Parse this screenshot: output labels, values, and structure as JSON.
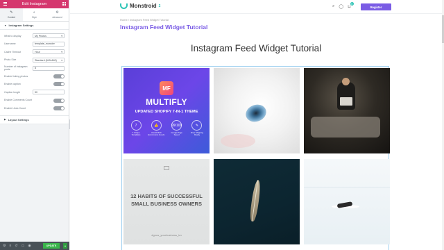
{
  "editor": {
    "title": "Edit Instagram",
    "tabs": [
      {
        "label": "Content",
        "icon": "pencil-icon"
      },
      {
        "label": "Style",
        "icon": "contrast-icon"
      },
      {
        "label": "Advanced",
        "icon": "gear-icon"
      }
    ],
    "section_instagram": "Instagram Settings",
    "controls": [
      {
        "label": "What to display",
        "type": "select",
        "value": "My Photos"
      },
      {
        "label": "Username",
        "type": "input",
        "value": "template_monster"
      },
      {
        "label": "Cache Timeout",
        "type": "select",
        "value": "Hour"
      },
      {
        "label": "Photo Size",
        "type": "select",
        "value": "Standard (640x640)"
      },
      {
        "label": "Number of instagram posts",
        "type": "input",
        "value": "8"
      },
      {
        "label": "Enable linking photos",
        "type": "toggle",
        "value": "Yes"
      },
      {
        "label": "Enable caption",
        "type": "toggle",
        "value": "Yes"
      },
      {
        "label": "Caption length",
        "type": "input",
        "value": "50"
      },
      {
        "label": "Enable Comments Count",
        "type": "toggle",
        "value": "Yes"
      },
      {
        "label": "Enable Likes Count",
        "type": "toggle",
        "value": "Yes"
      }
    ],
    "section_layout": "Layout Settings",
    "update_label": "UPDATE"
  },
  "site": {
    "logo": "Monstroid",
    "logo_sup": "2",
    "cart_count": "0",
    "register_label": "Register",
    "breadcrumb": "Home  /  Instagram Feed Widget Tutorial",
    "page_title": "Instagram Feed Widget Tutorial",
    "widget_title": "Instagram Feed Widget Tutorial"
  },
  "tiles": {
    "multifly": {
      "logo": "MF",
      "name": "MULTIFLY",
      "subtitle": "UPDATED SHOPIFY 7-IN-1 THEME",
      "features": [
        {
          "icon": "7",
          "text": "7 Unique Templates"
        },
        {
          "icon": "👍",
          "text": "Useful Multi Ecommerce Goods"
        },
        {
          "icon": "99/100",
          "text": "Google Page Speed"
        },
        {
          "icon": "✎",
          "text": "Drop Shipping Ready"
        }
      ]
    },
    "habits": {
      "headline": "12 HABITS OF SUCCESSFUL SMALL BUSINESS OWNERS",
      "hashtag": "#grow_yourbusiness_tm"
    }
  }
}
